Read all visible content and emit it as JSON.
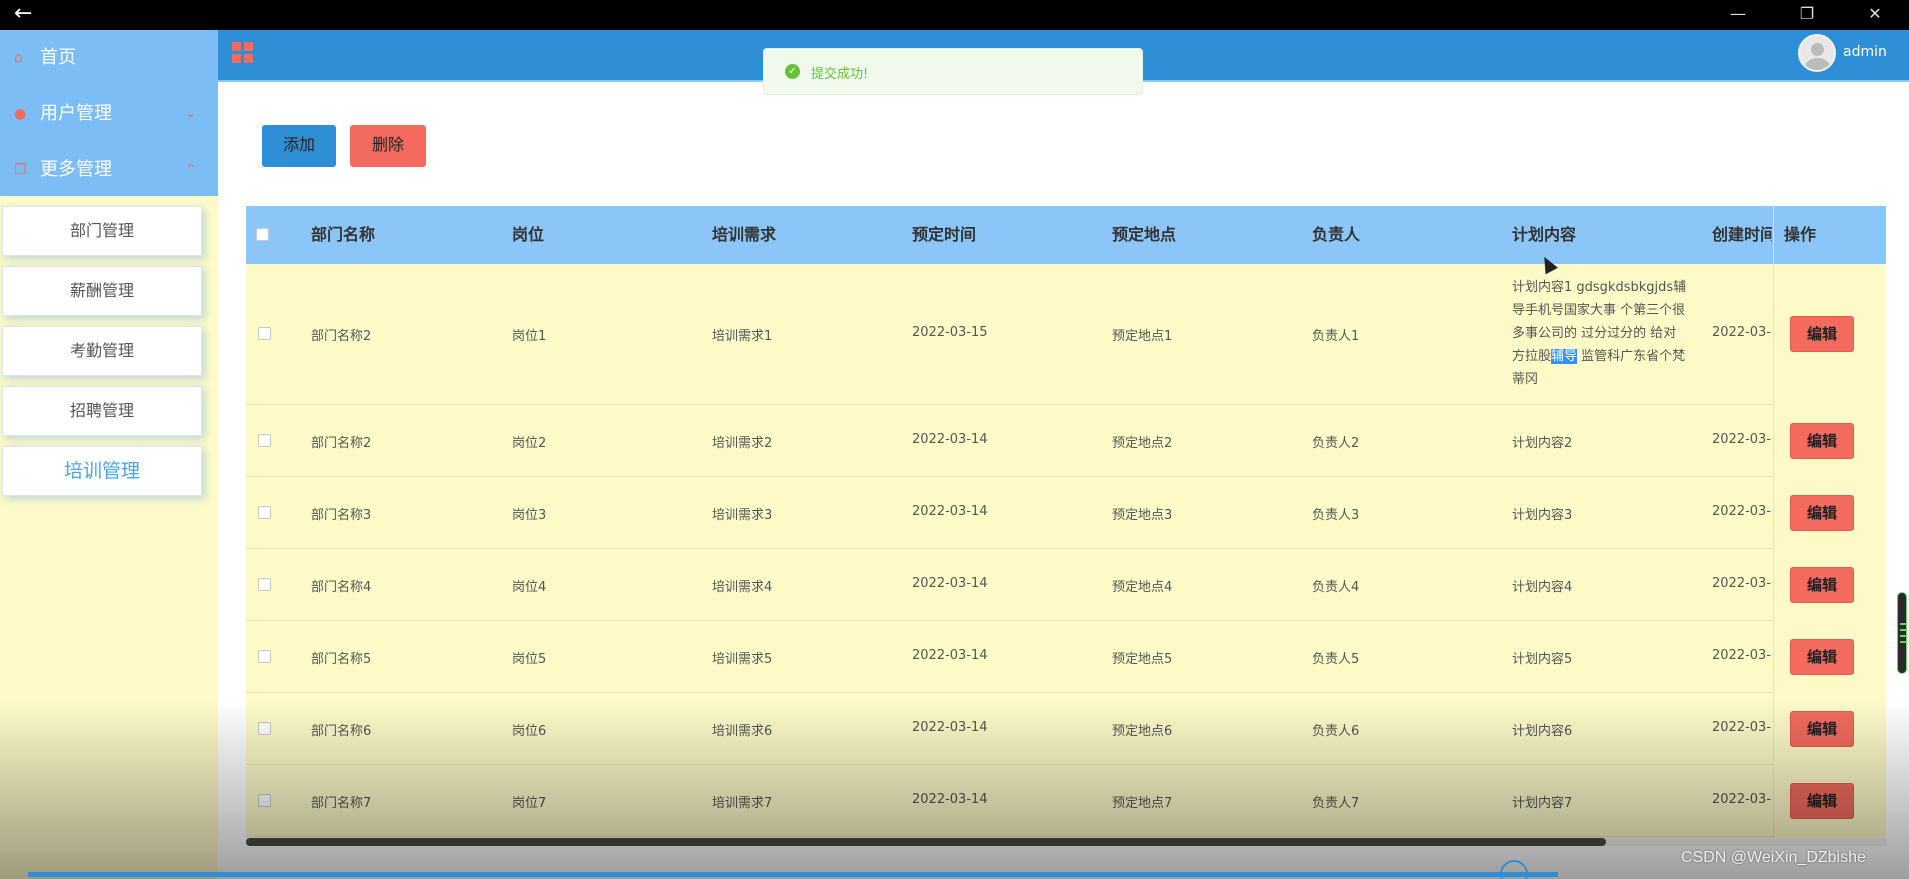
{
  "window": {
    "back_symbol": "←",
    "minimize_symbol": "—",
    "restore_symbol": "❐",
    "close_symbol": "✕"
  },
  "sidebar": {
    "nav": [
      {
        "label": "首页",
        "icon": "home-icon"
      },
      {
        "label": "用户管理",
        "icon": "user-icon",
        "arrow": "chevron-down-icon"
      },
      {
        "label": "更多管理",
        "icon": "copy-icon",
        "arrow": "chevron-up-icon"
      }
    ],
    "sub_items": [
      {
        "label": "部门管理"
      },
      {
        "label": "薪酬管理"
      },
      {
        "label": "考勤管理"
      },
      {
        "label": "招聘管理"
      },
      {
        "label": "培训管理",
        "active": true
      }
    ]
  },
  "header": {
    "menu_icon": "grid-icon",
    "username": "admin"
  },
  "toast": {
    "message": "提交成功!",
    "type": "success"
  },
  "toolbar": {
    "add_label": "添加",
    "delete_label": "删除"
  },
  "table": {
    "columns": [
      "部门名称",
      "岗位",
      "培训需求",
      "预定时间",
      "预定地点",
      "负责人",
      "计划内容",
      "创建时间",
      "操作"
    ],
    "edit_label": "编辑",
    "rows": [
      {
        "dept": "部门名称2",
        "post": "岗位1",
        "need": "培训需求1",
        "date": "2022-03-15",
        "place": "预定地点1",
        "owner": "负责人1",
        "plan_before": "计划内容1 gdsgkdsbkgjds辅导手机号国家大事 个第三个很多事公司的 过分过分的 给对方拉股",
        "plan_selected": "辅导",
        "plan_after": " 监管科广东省个梵蒂冈",
        "created": "2022-03-"
      },
      {
        "dept": "部门名称2",
        "post": "岗位2",
        "need": "培训需求2",
        "date": "2022-03-14",
        "place": "预定地点2",
        "owner": "负责人2",
        "plan": "计划内容2",
        "created": "2022-03-"
      },
      {
        "dept": "部门名称3",
        "post": "岗位3",
        "need": "培训需求3",
        "date": "2022-03-14",
        "place": "预定地点3",
        "owner": "负责人3",
        "plan": "计划内容3",
        "created": "2022-03-"
      },
      {
        "dept": "部门名称4",
        "post": "岗位4",
        "need": "培训需求4",
        "date": "2022-03-14",
        "place": "预定地点4",
        "owner": "负责人4",
        "plan": "计划内容4",
        "created": "2022-03-"
      },
      {
        "dept": "部门名称5",
        "post": "岗位5",
        "need": "培训需求5",
        "date": "2022-03-14",
        "place": "预定地点5",
        "owner": "负责人5",
        "plan": "计划内容5",
        "created": "2022-03-"
      },
      {
        "dept": "部门名称6",
        "post": "岗位6",
        "need": "培训需求6",
        "date": "2022-03-14",
        "place": "预定地点6",
        "owner": "负责人6",
        "plan": "计划内容6",
        "created": "2022-03-"
      },
      {
        "dept": "部门名称7",
        "post": "岗位7",
        "need": "培训需求7",
        "date": "2022-03-14",
        "place": "预定地点7",
        "owner": "负责人7",
        "plan": "计划内容7",
        "created": "2022-03-"
      }
    ]
  },
  "watermark": "CSDN @WeiXin_DZbishe",
  "colors": {
    "sidebar_top": "#7cbdf5",
    "sidebar_bg": "#fdfac8",
    "header": "#2e8fd6",
    "table_header": "#8cc6f8",
    "danger": "#f26b5e",
    "success": "#67c23a"
  }
}
